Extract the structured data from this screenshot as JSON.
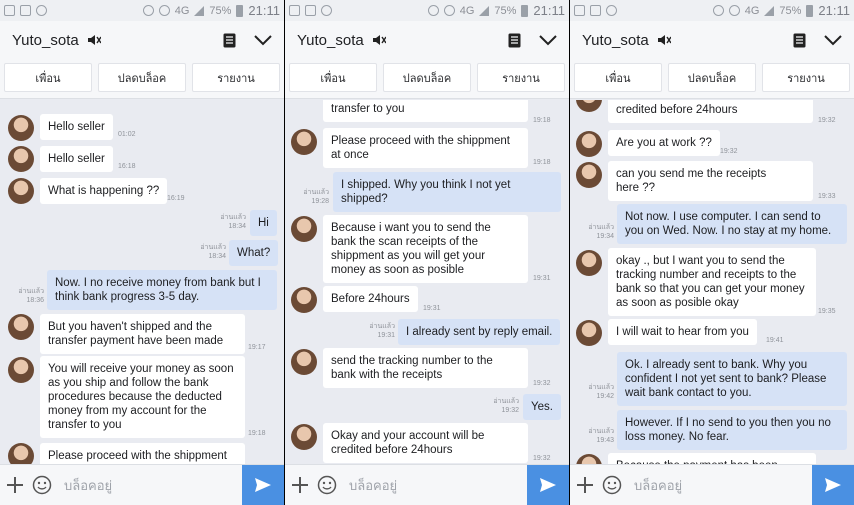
{
  "status": {
    "battery": "75%",
    "network": "4G",
    "time": "21:11"
  },
  "header": {
    "contact_name": "Yuto_sota"
  },
  "actions": {
    "friend": "เพื่อน",
    "unblock": "ปลดบล็อค",
    "report": "รายงาน"
  },
  "composer": {
    "placeholder": "บล็อคอยู่"
  },
  "read_label": "อ่านแล้ว",
  "panels": [
    {
      "messages": [
        {
          "dir": "in",
          "text": "Hello seller",
          "time": "01:02"
        },
        {
          "dir": "in",
          "text": "Hello seller",
          "time": "16:18"
        },
        {
          "dir": "in",
          "text": "What is happening ??",
          "time": "16:19"
        },
        {
          "dir": "out",
          "text": "Hi",
          "time": "18:34",
          "read": "อ่านแล้ว"
        },
        {
          "dir": "out",
          "text": "What?",
          "time": "18:34",
          "read": "อ่านแล้ว"
        },
        {
          "dir": "out",
          "text": "Now. I no receive money from bank but I\nthink bank progress 3-5 day.",
          "time": "18:36",
          "read": "อ่านแล้ว"
        },
        {
          "dir": "in",
          "text": "But you haven't shipped and the\ntransfer payment have been made",
          "time": "19:17"
        },
        {
          "dir": "in",
          "text": "You will receive your money as soon\nas you ship and follow the bank\nprocedures because the deducted\nmoney from my account for the\ntransfer to you",
          "time": "19:18"
        },
        {
          "dir": "in",
          "text": "Please proceed with the shippment",
          "time": ""
        }
      ]
    },
    {
      "messages": [
        {
          "dir": "in",
          "text": "transfer to you",
          "time": "19:18"
        },
        {
          "dir": "in",
          "text": "Please proceed with the shippment\nat once",
          "time": "19:18"
        },
        {
          "dir": "out",
          "text": "I shipped. Why you think I not yet\nshipped?",
          "time": "19:28",
          "read": "อ่านแล้ว"
        },
        {
          "dir": "in",
          "text": "Because i want you to send the\nbank the scan receipts of the\nshippment as you will get your\nmoney as soon as posible",
          "time": "19:31"
        },
        {
          "dir": "in",
          "text": "Before 24hours",
          "time": "19:31"
        },
        {
          "dir": "out",
          "text": "I already sent by reply email.",
          "time": "19:31",
          "read": "อ่านแล้ว"
        },
        {
          "dir": "in",
          "text": "send the tracking number to the\nbank with the receipts",
          "time": "19:32"
        },
        {
          "dir": "out",
          "text": "Yes.",
          "time": "19:32",
          "read": "อ่านแล้ว"
        },
        {
          "dir": "in",
          "text": "Okay and your account will be\ncredited before 24hours",
          "time": "19:32"
        }
      ]
    },
    {
      "messages": [
        {
          "dir": "in",
          "text": "credited before 24hours",
          "time": "19:32"
        },
        {
          "dir": "in",
          "text": "Are you at work ??",
          "time": "19:32"
        },
        {
          "dir": "in",
          "text": "can you send me the receipts\nhere ??",
          "time": "19:33"
        },
        {
          "dir": "out",
          "text": "Not now. I use computer. I can send to\nyou on Wed. Now. I no stay at my home.",
          "time": "19:34",
          "read": "อ่านแล้ว"
        },
        {
          "dir": "in",
          "text": "okay ., but I want you to send the\ntracking number and receipts to the\nbank so that you can get your money\nas soon as posible okay",
          "time": "19:35"
        },
        {
          "dir": "in",
          "text": "I will wait to hear from you",
          "time": "19:41"
        },
        {
          "dir": "out",
          "text": "Ok. I already sent to bank. Why you\nconfident I not yet sent to bank? Please\nwait bank contact to you.",
          "time": "19:42",
          "read": "อ่านแล้ว"
        },
        {
          "dir": "out",
          "text": "However. If I no send to you then you no\nloss money. No fear.",
          "time": "19:43",
          "read": "อ่านแล้ว"
        },
        {
          "dir": "in",
          "text": "Because the payment has been",
          "time": ""
        }
      ]
    }
  ]
}
